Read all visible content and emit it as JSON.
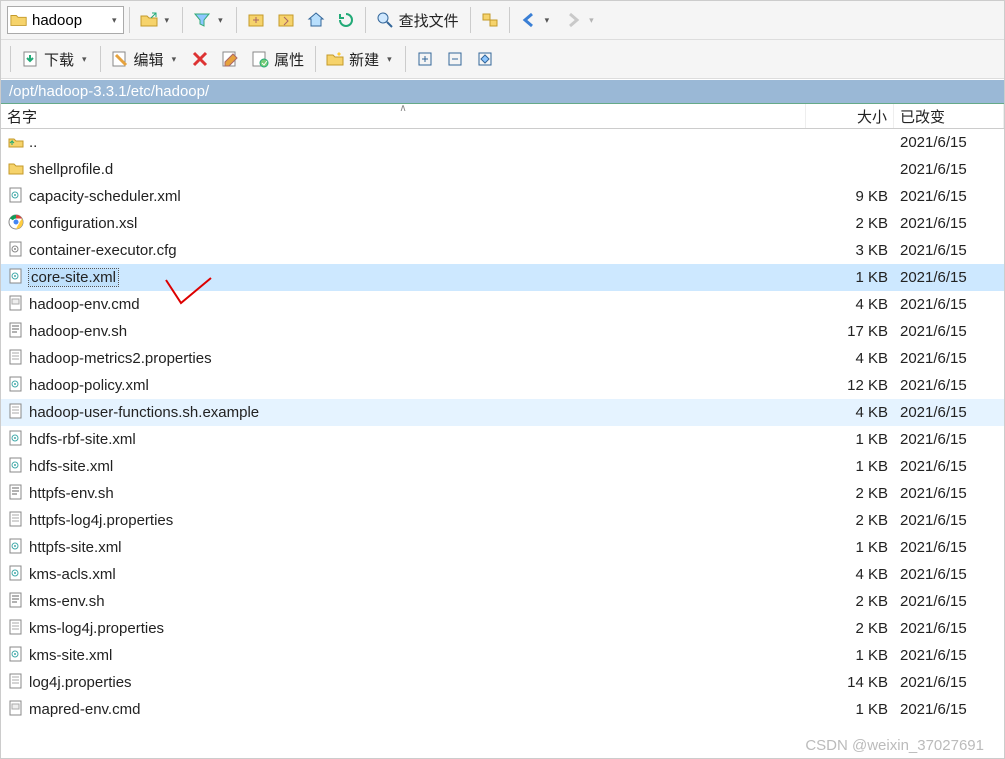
{
  "toolbar1": {
    "path_input": "hadoop",
    "find_label": "查找文件"
  },
  "toolbar2": {
    "download": "下载",
    "edit": "编辑",
    "properties": "属性",
    "new": "新建"
  },
  "address": "/opt/hadoop-3.3.1/etc/hadoop/",
  "columns": {
    "name": "名字",
    "size": "大小",
    "date": "已改变"
  },
  "rows": [
    {
      "icon": "up",
      "name": "..",
      "size": "",
      "date": "2021/6/15"
    },
    {
      "icon": "folder",
      "name": "shellprofile.d",
      "size": "",
      "date": "2021/6/15"
    },
    {
      "icon": "xml",
      "name": "capacity-scheduler.xml",
      "size": "9 KB",
      "date": "2021/6/15"
    },
    {
      "icon": "chrome",
      "name": "configuration.xsl",
      "size": "2 KB",
      "date": "2021/6/15"
    },
    {
      "icon": "cfg",
      "name": "container-executor.cfg",
      "size": "3 KB",
      "date": "2021/6/15"
    },
    {
      "icon": "xml",
      "name": "core-site.xml",
      "size": "1 KB",
      "date": "2021/6/15",
      "selected": true
    },
    {
      "icon": "cmd",
      "name": "hadoop-env.cmd",
      "size": "4 KB",
      "date": "2021/6/15"
    },
    {
      "icon": "sh",
      "name": "hadoop-env.sh",
      "size": "17 KB",
      "date": "2021/6/15"
    },
    {
      "icon": "txt",
      "name": "hadoop-metrics2.properties",
      "size": "4 KB",
      "date": "2021/6/15"
    },
    {
      "icon": "xml",
      "name": "hadoop-policy.xml",
      "size": "12 KB",
      "date": "2021/6/15"
    },
    {
      "icon": "txt",
      "name": "hadoop-user-functions.sh.example",
      "size": "4 KB",
      "date": "2021/6/15",
      "hover": true
    },
    {
      "icon": "xml",
      "name": "hdfs-rbf-site.xml",
      "size": "1 KB",
      "date": "2021/6/15"
    },
    {
      "icon": "xml",
      "name": "hdfs-site.xml",
      "size": "1 KB",
      "date": "2021/6/15"
    },
    {
      "icon": "sh",
      "name": "httpfs-env.sh",
      "size": "2 KB",
      "date": "2021/6/15"
    },
    {
      "icon": "txt",
      "name": "httpfs-log4j.properties",
      "size": "2 KB",
      "date": "2021/6/15"
    },
    {
      "icon": "xml",
      "name": "httpfs-site.xml",
      "size": "1 KB",
      "date": "2021/6/15"
    },
    {
      "icon": "xml",
      "name": "kms-acls.xml",
      "size": "4 KB",
      "date": "2021/6/15"
    },
    {
      "icon": "sh",
      "name": "kms-env.sh",
      "size": "2 KB",
      "date": "2021/6/15"
    },
    {
      "icon": "txt",
      "name": "kms-log4j.properties",
      "size": "2 KB",
      "date": "2021/6/15"
    },
    {
      "icon": "xml",
      "name": "kms-site.xml",
      "size": "1 KB",
      "date": "2021/6/15"
    },
    {
      "icon": "txt",
      "name": "log4j.properties",
      "size": "14 KB",
      "date": "2021/6/15"
    },
    {
      "icon": "cmd",
      "name": "mapred-env.cmd",
      "size": "1 KB",
      "date": "2021/6/15"
    }
  ],
  "watermark": "CSDN @weixin_37027691"
}
